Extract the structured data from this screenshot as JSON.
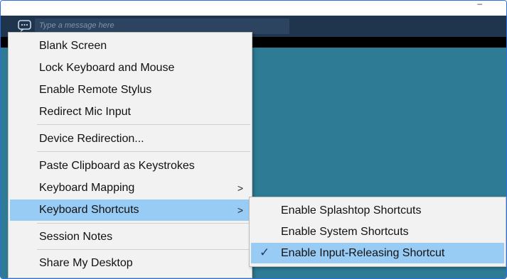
{
  "window": {
    "minimize_label": "–"
  },
  "toolbar": {
    "chat_placeholder": "Type a message here"
  },
  "menu": {
    "items": [
      {
        "label": "Blank Screen"
      },
      {
        "label": "Lock Keyboard and Mouse"
      },
      {
        "label": "Enable Remote Stylus"
      },
      {
        "label": "Redirect Mic Input"
      },
      {
        "label": "Device Redirection..."
      },
      {
        "label": "Paste Clipboard as Keystrokes"
      },
      {
        "label": "Keyboard Mapping",
        "arrow": ">"
      },
      {
        "label": "Keyboard Shortcuts",
        "arrow": ">",
        "highlighted": true
      },
      {
        "label": "Session Notes"
      },
      {
        "label": "Share My Desktop"
      }
    ]
  },
  "submenu": {
    "items": [
      {
        "label": "Enable Splashtop Shortcuts"
      },
      {
        "label": "Enable System Shortcuts"
      },
      {
        "label": "Enable Input-Releasing Shortcut",
        "checked": true,
        "check": "✓",
        "highlighted": true
      }
    ]
  },
  "colors": {
    "toolbar": "#1f344d",
    "remote_background": "#2d7b94",
    "menu_background": "#f2f2f2",
    "highlight": "#99ccf5",
    "frame_border": "#2a6fdb"
  }
}
